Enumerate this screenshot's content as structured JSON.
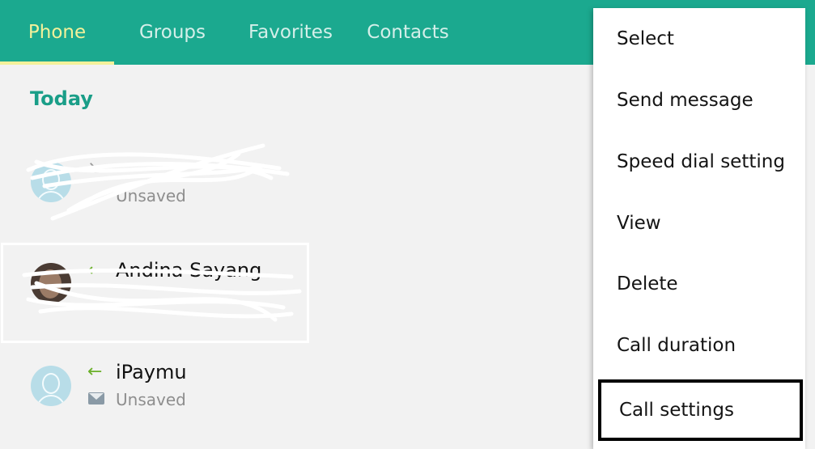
{
  "tabs": [
    {
      "label": "Phone",
      "active": true
    },
    {
      "label": "Groups",
      "active": false
    },
    {
      "label": "Favorites",
      "active": false
    },
    {
      "label": "Contacts",
      "active": false
    }
  ],
  "colors": {
    "accent": "#1ba98f",
    "active_tab": "#f3f19a",
    "section_title": "#1a9e88",
    "incoming_arrow": "#6bb02a"
  },
  "log": {
    "section_title": "Today",
    "items": [
      {
        "name": "",
        "sub_label": "Unsaved",
        "direction": "missed",
        "avatar": "person-placeholder-icon",
        "redacted": true
      },
      {
        "name": "Andina Sayang",
        "sub_label": "",
        "direction": "incoming",
        "avatar": "photo",
        "redacted": true
      },
      {
        "name": "iPaymu",
        "sub_label": "Unsaved",
        "direction": "incoming",
        "avatar": "person-placeholder-icon",
        "sub_icon": "envelope-icon"
      }
    ]
  },
  "menu": {
    "items": [
      {
        "label": "Select"
      },
      {
        "label": "Send message"
      },
      {
        "label": "Speed dial setting"
      },
      {
        "label": "View"
      },
      {
        "label": "Delete"
      },
      {
        "label": "Call duration"
      },
      {
        "label": "Call settings",
        "highlighted": true
      }
    ]
  }
}
